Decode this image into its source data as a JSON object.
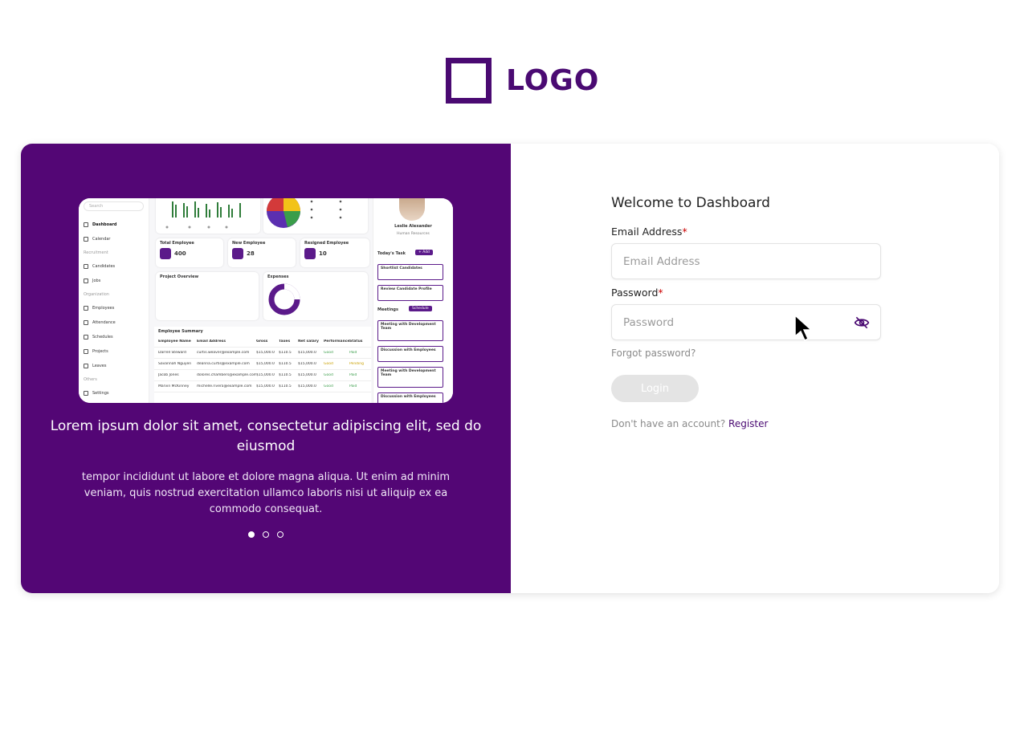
{
  "logo": {
    "text": "LOGO"
  },
  "hero": {
    "title": "Lorem ipsum dolor sit amet, consectetur adipiscing elit, sed do eiusmod",
    "text": "tempor incididunt ut labore et dolore magna aliqua. Ut enim ad minim veniam, quis nostrud exercitation ullamco laboris nisi ut aliquip ex ea commodo consequat.",
    "carousel_active_index": 0,
    "carousel_count": 3
  },
  "preview": {
    "search": "Search",
    "nav": [
      "Dashboard",
      "Calendar",
      "Recruitment",
      "Candidates",
      "Jobs",
      "Organization",
      "Employees",
      "Attendance",
      "Schedules",
      "Projects",
      "Leaves",
      "Others",
      "Settings"
    ],
    "stats": [
      {
        "title": "Total Employee",
        "value": "400"
      },
      {
        "title": "New Employee",
        "value": "28"
      },
      {
        "title": "Resigned Employee",
        "value": "10"
      }
    ],
    "project_overview": "Project Overview",
    "expenses": "Expenses",
    "employee_summary": "Employee Summary",
    "profile_name": "Leslie Alexander",
    "profile_role": "Human Resources",
    "todays_task": "Today's Task",
    "add": "+ Add",
    "meetings": "Meetings",
    "schedule": "Schedule",
    "tasks": [
      "Shortlist Candidates",
      "Review Candidate Profile"
    ],
    "meeting_items": [
      "Meeting with Development Team",
      "Discussion with Employees",
      "Meeting with Development Team",
      "Discussion with Employees"
    ],
    "table_headers": [
      "Employee Name",
      "Email Address",
      "Gross",
      "Taxes",
      "Net salary",
      "Performance",
      "Status"
    ],
    "table_rows": [
      [
        "Darrell Steward",
        "curtis.weaver@example.com",
        "$15,000.0",
        "$110.5",
        "$15,000.0",
        "Good",
        "Paid"
      ],
      [
        "Savannah Nguyen",
        "deanna.curtis@example.com",
        "$15,000.0",
        "$110.5",
        "$15,000.0",
        "Good",
        "Pending"
      ],
      [
        "Jacob Jones",
        "dolores.chambers@example.com",
        "$15,000.0",
        "$110.5",
        "$15,000.0",
        "Good",
        "Paid"
      ],
      [
        "Marvin McKinney",
        "michelle.rivera@example.com",
        "$15,000.0",
        "$110.5",
        "$15,000.0",
        "Good",
        "Paid"
      ]
    ]
  },
  "form": {
    "welcome": "Welcome to Dashboard",
    "email_label": "Email Address",
    "email_placeholder": "Email Address",
    "password_label": "Password",
    "password_placeholder": "Password",
    "required_mark": "*",
    "forgot": "Forgot password?",
    "login": "Login",
    "no_account": "Don't have an account?",
    "register": "Register"
  },
  "colors": {
    "brand": "#530675",
    "accent": "#4a0a72"
  }
}
